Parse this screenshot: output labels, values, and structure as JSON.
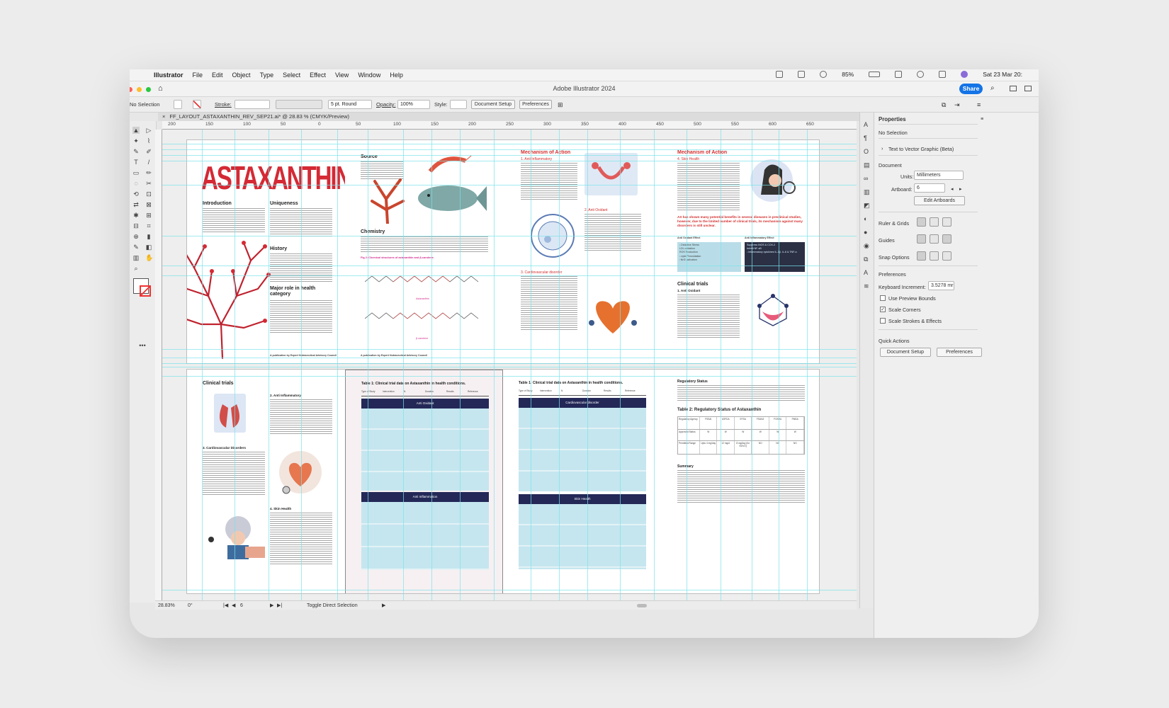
{
  "menubar": {
    "apple": "",
    "items": [
      "Illustrator",
      "File",
      "Edit",
      "Object",
      "Type",
      "Select",
      "Effect",
      "View",
      "Window",
      "Help"
    ],
    "battery": "85%",
    "datetime": "Sat 23 Mar  20:"
  },
  "titlebar": {
    "title": "Adobe Illustrator 2024",
    "share": "Share"
  },
  "control": {
    "selection": "No Selection",
    "stroke": "Stroke:",
    "brush": "5 pt. Round",
    "opacity_label": "Opacity:",
    "opacity": "100%",
    "style_label": "Style:",
    "doc_setup": "Document Setup",
    "prefs": "Preferences"
  },
  "doctab": {
    "name": "FF_LAYOUT_ASTAXANTHIN_REV_SEP21.ai* @ 28.83 % (CMYK/Preview)"
  },
  "ruler": [
    "200",
    "150",
    "100",
    "50",
    "0",
    "50",
    "100",
    "150",
    "200",
    "250",
    "300",
    "350",
    "400",
    "450",
    "500",
    "550",
    "600",
    "650"
  ],
  "status": {
    "zoom": "28.83%",
    "angle": "0°",
    "artboard": "6",
    "tool": "Toggle Direct Selection"
  },
  "properties": {
    "title": "Properties",
    "selection": "No Selection",
    "text_to_vector": "Text to Vector Graphic (Beta)",
    "document": "Document",
    "units_label": "Units:",
    "units": "Millimeters",
    "artboard_label": "Artboard:",
    "artboard": "6",
    "edit_artboards": "Edit Artboards",
    "ruler_grids": "Ruler & Grids",
    "guides": "Guides",
    "snap": "Snap Options",
    "preferences": "Preferences",
    "keyboard_inc_label": "Keyboard Increment:",
    "keyboard_inc": "3.5278 mr",
    "use_preview": "Use Preview Bounds",
    "scale_corners": "Scale Corners",
    "scale_strokes": "Scale Strokes & Effects",
    "quick_actions": "Quick Actions",
    "doc_setup": "Document Setup",
    "prefs": "Preferences"
  },
  "artwork": {
    "p1": {
      "title": "ASTAXANTHIN",
      "intro": "Introduction",
      "unique": "Uniqueness",
      "history": "History",
      "major": "Major role in health category",
      "footer": "A publication by Expert Nutraceutical Advisory Council"
    },
    "p2": {
      "source": "Source",
      "chemistry": "Chemistry",
      "fig": "Fig 2: Chemical structures of astaxanthin and β-carotene.",
      "astax": "Astaxanthin",
      "beta": "β-carotene",
      "footer": "A publication by Expert Nutraceutical Advisory Council"
    },
    "p3": {
      "mech": "Mechanism of Action",
      "s1": "1. Anti Inflammatory",
      "s2": "2. Anti Oxidant",
      "s3": "3. Cardiovascular disorder"
    },
    "p4": {
      "mech": "Mechanism of Action",
      "s4": "4. Skin Health",
      "callout": "AX has shown many potential benefits in several diseases in preclinical studies, however, due to the limited number of clinical trials, its mechanism against many disorders is still unclear.",
      "col1": "Anti Oxidant Effect",
      "col2": "Anti Inflammatory Effect",
      "list1": [
        "↓Oxidative Stress",
        "LDL oxidation",
        "ROS Production",
        "↓Lipid Peroxidation",
        "↑Nrf2 activation"
      ],
      "list2": [
        "Suppress iNOS & COX-2",
        "Inhibit NF-κB",
        "↓Inflammatory cytokines IL-1β, IL-6 & TNF-α"
      ],
      "clinical": "Clinical trials",
      "ao": "1. Anti Oxidant"
    },
    "p5": {
      "clinical": "Clinical trials",
      "ai": "2. Anti Inflammatory",
      "cv": "3. Cardiovascular Disorders",
      "sh": "4. Skin Health"
    },
    "p6": {
      "table": "Table 1: Clinical trial data on Astaxanthin in health conditions.",
      "heads": [
        "Type of Study",
        "Intervention",
        "N",
        "Duration",
        "Results",
        "Reference"
      ],
      "band1": "Anti Oxidant",
      "band2": "Anti Inflammation"
    },
    "p7": {
      "table": "Table 1: Clinical trial data on Astaxanthin in health conditions.",
      "heads": [
        "Type of Study",
        "Intervention",
        "N",
        "Duration",
        "Results",
        "Reference"
      ],
      "band1": "Cardiovascular disorder",
      "band2": "Skin Health"
    },
    "p8": {
      "reg": "Regulatory Status",
      "table2": "Table 2: Regulatory Status of Astaxanthin",
      "heads": [
        "Regulatory Agency",
        "FSSAI",
        "USFDA",
        "EFSA",
        "FSANZ",
        "FOSHU",
        "PMDA"
      ],
      "row1": "Approved Status",
      "row2": "Permitted Range",
      "ranges": [
        "Upto 4 mg/day",
        "12 mg/d",
        "8 mg/day (for NOVO)",
        "NO",
        "NO",
        "NO"
      ],
      "summary": "Summary"
    }
  },
  "colors": {
    "accent": "#d32f2f",
    "navy": "#232857",
    "teal": "#c5e6ef",
    "guide": "#7be3ea",
    "share": "#1473e6"
  }
}
